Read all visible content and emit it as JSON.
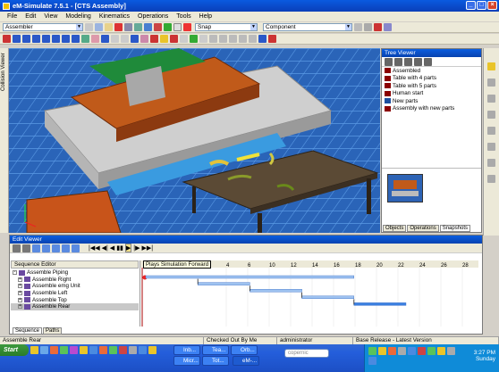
{
  "window": {
    "title": "eM-Simulate 7.5.1 - [CTS Assembly]"
  },
  "menu": [
    "File",
    "Edit",
    "View",
    "Modeling",
    "Kinematics",
    "Operations",
    "Tools",
    "Help"
  ],
  "toolbar": {
    "mode_combo": "Assembler",
    "snap_combo": "Snap",
    "component_combo": "Component"
  },
  "left_strip_label": "Collision Viewer",
  "tree_viewer": {
    "title": "Tree Viewer",
    "items": [
      {
        "label": "Assembled",
        "color": "#8b0000"
      },
      {
        "label": "Table with 4 parts",
        "color": "#8b0000"
      },
      {
        "label": "Table with 5 parts",
        "color": "#8b0000"
      },
      {
        "label": "Human start",
        "color": "#8b0000"
      },
      {
        "label": "New parts",
        "color": "#1d4f9f"
      },
      {
        "label": "Assembly with new parts",
        "color": "#8b0000"
      }
    ],
    "tabs": [
      "Objects",
      "Operations",
      "Snapshots"
    ]
  },
  "edit_viewer": {
    "title": "Edit Viewer",
    "tooltip": "Plays Simulation Forward",
    "sequence_editor": {
      "header": "Sequence Editor",
      "root": "Assemble Piping",
      "children": [
        "Assemble Right",
        "Assemble emg Unit",
        "Assemble Left",
        "Assemble Top",
        "Assemble Rear"
      ]
    },
    "timeline_ticks": [
      "4",
      "6",
      "10",
      "12",
      "14",
      "16",
      "18",
      "20",
      "22",
      "24",
      "26",
      "28",
      "30",
      "32",
      "34"
    ],
    "tabs": [
      "Sequence",
      "Paths"
    ]
  },
  "gantt_bars": [
    {
      "start": 0,
      "end": 24
    },
    {
      "start": 6,
      "end": 12
    },
    {
      "start": 12,
      "end": 18
    },
    {
      "start": 18,
      "end": 24
    },
    {
      "start": 24,
      "end": 30
    }
  ],
  "status": {
    "selected": "Assemble Rear",
    "checked_out": "Checked Out By Me",
    "user": "administrator",
    "release": "Base Release - Latest Version"
  },
  "taskbar": {
    "start": "Start",
    "items": [
      "Inb...",
      "Tea...",
      "Orb...",
      "eM-...",
      "Micr...",
      "Tot..."
    ],
    "search": "copernic",
    "clock": "3:27 PM",
    "day": "Sunday"
  }
}
